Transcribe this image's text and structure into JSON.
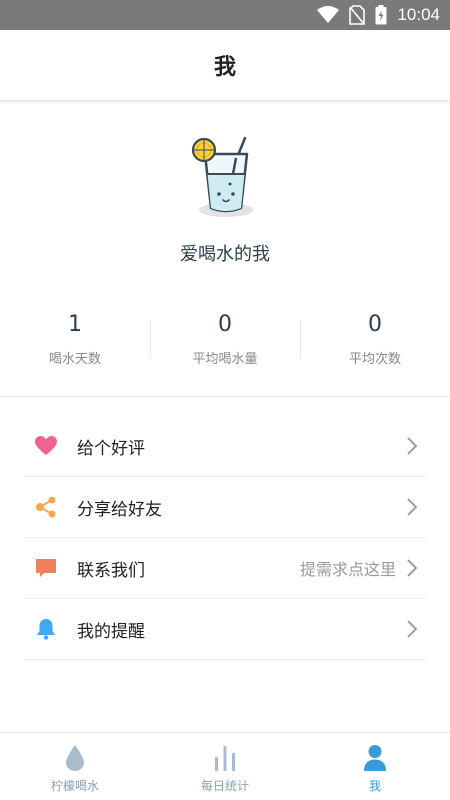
{
  "status_bar": {
    "time": "10:04"
  },
  "header": {
    "title": "我"
  },
  "profile": {
    "name": "爱喝水的我"
  },
  "stats": [
    {
      "value": "1",
      "label": "喝水天数"
    },
    {
      "value": "0",
      "label": "平均喝水量"
    },
    {
      "value": "0",
      "label": "平均次数"
    }
  ],
  "menu": [
    {
      "label": "给个好评",
      "icon": "heart-icon",
      "extra": ""
    },
    {
      "label": "分享给好友",
      "icon": "share-icon",
      "extra": ""
    },
    {
      "label": "联系我们",
      "icon": "message-icon",
      "extra": "提需求点这里"
    },
    {
      "label": "我的提醒",
      "icon": "bell-icon",
      "extra": ""
    }
  ],
  "tabs": [
    {
      "label": "柠檬喝水",
      "icon": "water-drop-icon",
      "active": false
    },
    {
      "label": "每日统计",
      "icon": "bar-chart-icon",
      "active": false
    },
    {
      "label": "我",
      "icon": "person-icon",
      "active": true
    }
  ],
  "colors": {
    "accent": "#3a9ad9",
    "heart": "#f06292",
    "share": "#f5a94f",
    "message": "#f07f5e",
    "bell": "#3fa9f5"
  }
}
